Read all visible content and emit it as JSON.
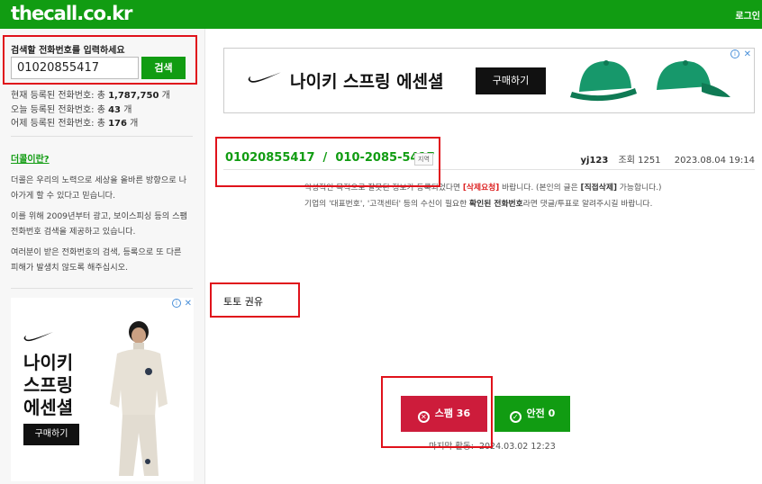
{
  "header": {
    "logo": "thecall.co.kr",
    "login": "로그인",
    "color": "#119c12"
  },
  "search": {
    "title": "검색할 전화번호를 입력하세요",
    "value": "01020855417",
    "button": "검색"
  },
  "stats": [
    {
      "label": "현재 등록된 전화번호: 총",
      "value": "1,787,750",
      "unit": "개"
    },
    {
      "label": "오늘 등록된 전화번호: 총",
      "value": "43",
      "unit": "개"
    },
    {
      "label": "어제 등록된 전화번호: 총",
      "value": "176",
      "unit": "개"
    }
  ],
  "about": {
    "link": "더콜이란?",
    "p1a": "더콜은 우리의 노력으로 세상을 올바른 방향으로 나",
    "p1b": "아가게 할 수 있다고 믿습니다.",
    "p2a": "이를 위해 2009년부터 광고, 보이스피싱 등의 스팸",
    "p2b": "전화번호 검색을 제공하고 있습니다.",
    "p3a": "여러분이 받은 전화번호의 검색, 등록으로 또 다른",
    "p3b": "피해가 발생치 않도록 해주십시오."
  },
  "side_ad": {
    "line1": "나이키",
    "line2": "스프링",
    "line3": "에센셜",
    "button": "구매하기",
    "close": "✕",
    "info": "i"
  },
  "top_ad": {
    "text": "나이키 스프링 에센셜",
    "button": "구매하기",
    "close": "✕",
    "info": "i"
  },
  "post": {
    "number": "01020855417  /  010-2085-5417",
    "region": "지역",
    "user": "yj123",
    "views": "조회 1251",
    "date": "2023.08.04 19:14",
    "notice1_a": "악성적인 목적으로 잘못된 정보가 등록되었다면",
    "notice1_req": "[삭제요청]",
    "notice1_b": "바랍니다. (본인의 글은",
    "notice1_self": "[직접삭제]",
    "notice1_c": "가능합니다.)",
    "notice2_a": "기업의 '대표번호', '고객센터' 등의 수신이 필요한 ",
    "notice2_b": "확인된 전화번호",
    "notice2_c": "라면 댓글/투표로 알려주시길 바랍니다.",
    "body": "토토 권유"
  },
  "votes": {
    "spam_label": "스팸 36",
    "safe_label": "안전 0",
    "last_activity_label": "마지막 활동:",
    "last_activity_value": "2024.03.02 12:23",
    "spam_color": "#cd1c3b",
    "safe_color": "#119c12"
  }
}
